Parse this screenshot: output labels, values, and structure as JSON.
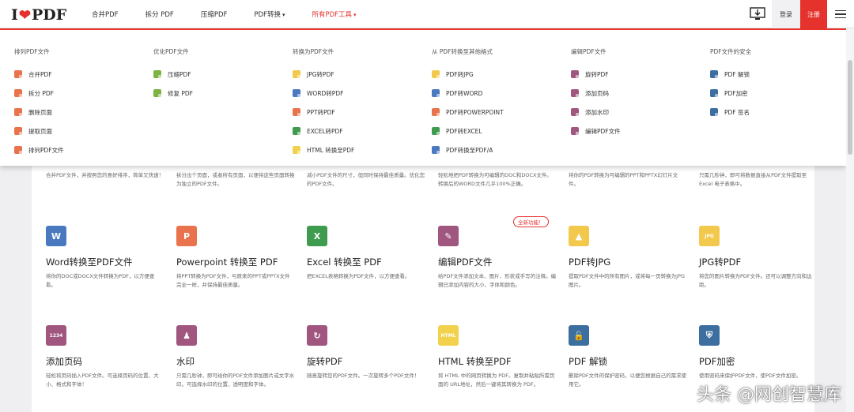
{
  "header": {
    "logo_left": "I",
    "logo_right": "PDF",
    "nav": [
      {
        "label": "合并PDF"
      },
      {
        "label": "拆分 PDF"
      },
      {
        "label": "压缩PDF"
      },
      {
        "label": "PDF转换",
        "caret": "▾"
      },
      {
        "label": "所有PDF工具",
        "caret": "▾"
      }
    ],
    "login": "登录",
    "register": "注册"
  },
  "menu": {
    "columns": [
      {
        "title": "排列PDF文件",
        "items": [
          {
            "label": "合并PDF",
            "color": "#e8734d"
          },
          {
            "label": "拆分 PDF",
            "color": "#e8734d"
          },
          {
            "label": "删除页面",
            "color": "#e8734d"
          },
          {
            "label": "提取页面",
            "color": "#e8734d"
          },
          {
            "label": "排列PDF文件",
            "color": "#e8734d"
          }
        ]
      },
      {
        "title": "优化PDF文件",
        "items": [
          {
            "label": "压缩PDF",
            "color": "#7cb342"
          },
          {
            "label": "修复 PDF",
            "color": "#7cb342"
          }
        ]
      },
      {
        "title": "转换为PDF文件",
        "items": [
          {
            "label": "JPG转PDF",
            "color": "#f2c94c"
          },
          {
            "label": "WORD转PDF",
            "color": "#4a79c0"
          },
          {
            "label": "PPT转PDF",
            "color": "#e8734d"
          },
          {
            "label": "EXCEL转PDF",
            "color": "#3f9b4e"
          },
          {
            "label": "HTML 转换至PDF",
            "color": "#f2d24c"
          }
        ]
      },
      {
        "title": "从 PDF转换至其他格式",
        "items": [
          {
            "label": "PDF转JPG",
            "color": "#f2c94c"
          },
          {
            "label": "PDF转WORD",
            "color": "#4a79c0"
          },
          {
            "label": "PDF转POWERPOINT",
            "color": "#e8734d"
          },
          {
            "label": "PDF转EXCEL",
            "color": "#3f9b4e"
          },
          {
            "label": "PDF转换至PDF/A",
            "color": "#4a79c0"
          }
        ]
      },
      {
        "title": "编辑PDF文件",
        "items": [
          {
            "label": "旋转PDF",
            "color": "#a0567f"
          },
          {
            "label": "添加页码",
            "color": "#a0567f"
          },
          {
            "label": "添加水印",
            "color": "#a0567f"
          },
          {
            "label": "编辑PDF文件",
            "color": "#a0567f"
          }
        ]
      },
      {
        "title": "PDF文件的安全",
        "items": [
          {
            "label": "PDF 解锁",
            "color": "#3c6ea0"
          },
          {
            "label": "PDF加密",
            "color": "#3c6ea0"
          },
          {
            "label": "PDF 签名",
            "color": "#3c6ea0"
          }
        ]
      }
    ]
  },
  "cards_partial": [
    {
      "desc": "合并PDF文件，并按照您的意好排序，简单又快速！"
    },
    {
      "desc": "拆分出个页面，或者所有页面，以便将这些页面转换为独立的PDF文件。"
    },
    {
      "desc": "减小PDF文件的尺寸，但同时保持最佳质量。优化您的PDF文件。"
    },
    {
      "desc": "轻松地把PDF转换为可编辑的DOC和DOCX文件。转换后的WORD文件几乎100%正确。"
    },
    {
      "desc": "将你的PDF转换为可编辑的PPT和PPTX幻灯片文件。"
    },
    {
      "desc": "只需几秒钟，即可将数据直接从PDF文件提取至Excel 电子表格中。"
    }
  ],
  "cards_row2": [
    {
      "title": "Word转换至PDF文件",
      "desc": "将你的DOC或DOCX文件转换为PDF，以方便查看。",
      "icon": "W",
      "color": "#4a79c0"
    },
    {
      "title": "Powerpoint 转换至 PDF",
      "desc": "将PPT转换为PDF文件，与原来的PPT或PPTX文件完全一样，并保持最佳质量。",
      "icon": "P",
      "color": "#e8734d"
    },
    {
      "title": "Excel 转换至 PDF",
      "desc": "把EXCEL表格转换为PDF文件，以方便查看。",
      "icon": "X",
      "color": "#3f9b4e"
    },
    {
      "title": "编辑PDF文件",
      "desc": "给PDF文件添加文本、图片、形状或手写的注释。编辑已添加内容的大小、字体和颜色。",
      "icon": "✎",
      "color": "#a0567f"
    },
    {
      "title": "PDF转JPG",
      "desc": "提取PDF文件中的所有图片，或将每一页转换为JPG图片。",
      "icon": "▲",
      "color": "#f2c94c"
    },
    {
      "title": "JPG转PDF",
      "desc": "将您的图片转换为PDF文件。还可以调整方向和边距。",
      "icon": "JPG",
      "color": "#f2c94c"
    }
  ],
  "badge_new": "全新功能！",
  "cards_row3": [
    {
      "title": "添加页码",
      "desc": "轻松将页码插入PDF文件。可选择页码的位置、大小、格式和字体！",
      "icon": "1234",
      "color": "#a0567f"
    },
    {
      "title": "水印",
      "desc": "只需几秒钟，即可给你的PDF文件添加图片或文字水印。可选择水印的位置、透明度和字体。",
      "icon": "♟",
      "color": "#a0567f"
    },
    {
      "title": "旋转PDF",
      "desc": "随意旋转您的PDF文件。一次旋转多个PDF文件！",
      "icon": "↻",
      "color": "#a0567f"
    },
    {
      "title": "HTML 转换至PDF",
      "desc": "将 HTML 中的网页转换为 PDF。复制并粘贴所需页面的 URL地址，然后一键将其转换为 PDF。",
      "icon": "HTML",
      "color": "#f2d24c"
    },
    {
      "title": "PDF 解锁",
      "desc": "删除PDF文件的保护密码，以便您根据自己的需求使用它。",
      "icon": "🔓",
      "color": "#3c6ea0"
    },
    {
      "title": "PDF加密",
      "desc": "使用密码来保护PDF文件，使PDF文件加密。",
      "icon": "⛨",
      "color": "#3c6ea0"
    }
  ],
  "watermark": "头条 @网创智慧库"
}
